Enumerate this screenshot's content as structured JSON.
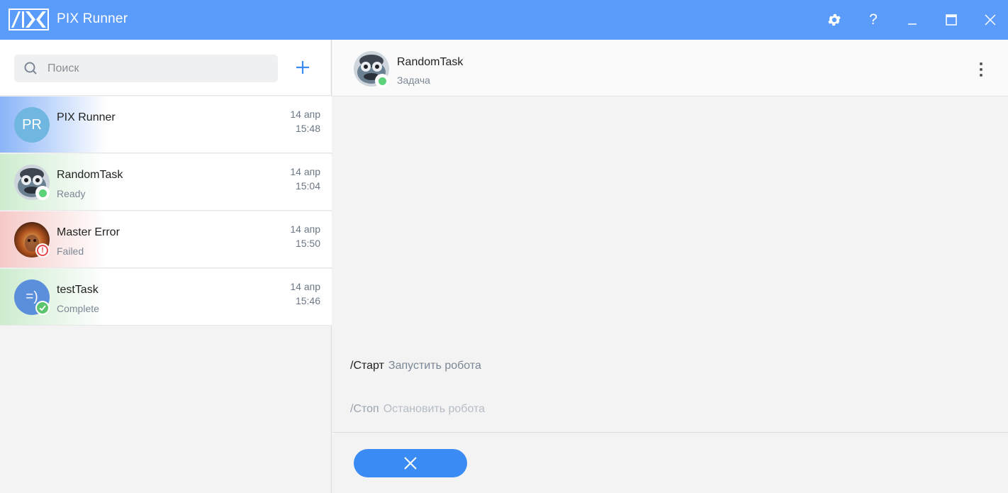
{
  "app": {
    "title": "PIX Runner"
  },
  "titlebar": {
    "icons": [
      "gear-icon",
      "help-icon",
      "minimize-icon",
      "maximize-icon",
      "close-icon"
    ],
    "color": "#5b9bf9"
  },
  "search": {
    "placeholder": "Поиск",
    "value": ""
  },
  "chats": [
    {
      "name": "PIX Runner",
      "status": "",
      "date": "14 апр",
      "time": "15:48",
      "avatar_text": "PR",
      "tint": "#8ab4f8"
    },
    {
      "name": "RandomTask",
      "status": "Ready",
      "date": "14 апр",
      "time": "15:04",
      "badge": "online-dot-icon",
      "tint": "#cdeccf"
    },
    {
      "name": "Master Error",
      "status": "Failed",
      "date": "14 апр",
      "time": "15:50",
      "badge": "error-icon",
      "tint": "#f5c9c7"
    },
    {
      "name": "testTask",
      "status": "Complete",
      "date": "14 апр",
      "time": "15:46",
      "avatar_text": "=)",
      "badge": "check-icon",
      "tint": "#cdeccf"
    }
  ],
  "conversation": {
    "name": "RandomTask",
    "subtitle": "Задача"
  },
  "commands": [
    {
      "cmd": "/Старт",
      "desc": "Запустить робота"
    },
    {
      "cmd": "/Стоп",
      "desc": "Остановить робота"
    }
  ],
  "colors": {
    "accent": "#3b8bf4",
    "online": "#5cd27a",
    "error": "#e5484d",
    "complete": "#5cc46f"
  }
}
